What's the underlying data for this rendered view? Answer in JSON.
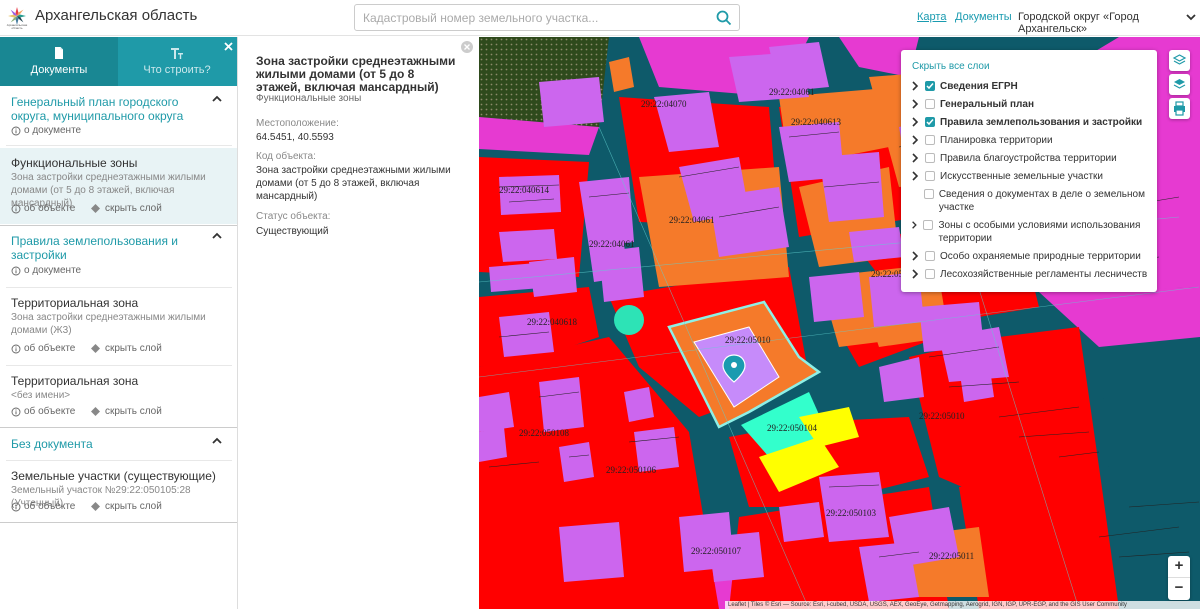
{
  "header": {
    "logo_text": "Архангельская область",
    "title": "Архангельская область",
    "search_placeholder": "Кадастровый номер земельного участка...",
    "nav_map": "Карта",
    "nav_docs": "Документы",
    "district": "Городской округ «Город Архангельск»"
  },
  "tabs": {
    "documents": "Документы",
    "what_to_build": "Что строить?"
  },
  "left": {
    "sec1_title": "Генеральный план городского округа, муниципального округа",
    "sec1_about": "о документе",
    "func_title": "Функциональные зоны",
    "func_sub": "Зона застройки среднеэтажными жилыми домами (от 5 до 8 этажей, включая мансардный)",
    "about_object": "об объекте",
    "hide_layer": "скрыть слой",
    "sec2_title": "Правила землепользования и застройки",
    "sec2_about": "о документе",
    "terr1_title": "Территориальная зона",
    "terr1_sub": "Зона застройки среднеэтажными жилыми домами (Ж3)",
    "terr2_title": "Территориальная зона",
    "terr2_sub": "<без имени>",
    "sec3_title": "Без документа",
    "land_title": "Земельные участки (существующие)",
    "land_sub": "Земельный участок №29:22:050105:28 (Учтенный)"
  },
  "info": {
    "title": "Зона застройки среднеэтажными жилыми домами (от 5 до 8 этажей, включая мансардный)",
    "subtitle": "Функциональные зоны",
    "location_label": "Местоположение:",
    "location_value": "64.5451, 40.5593",
    "code_label": "Код объекта:",
    "code_value": "Зона застройки среднеэтажными жилыми домами (от 5 до 8 этажей, включая мансардный)",
    "status_label": "Статус объекта:",
    "status_value": "Существующий"
  },
  "layers": {
    "hide_all": "Скрыть все слои",
    "items": [
      {
        "label": "Сведения ЕГРН",
        "checked": true,
        "bold": true
      },
      {
        "label": "Генеральный план",
        "checked": false,
        "bold": true
      },
      {
        "label": "Правила землепользования и застройки",
        "checked": true,
        "bold": true
      },
      {
        "label": "Планировка территории",
        "checked": false,
        "bold": false
      },
      {
        "label": "Правила благоустройства территории",
        "checked": false,
        "bold": false
      },
      {
        "label": "Искусственные земельные участки",
        "checked": false,
        "bold": false
      },
      {
        "label": "Сведения о документах в деле о земельном участке",
        "checked": false,
        "bold": false
      },
      {
        "label": "Зоны с особыми условиями использования территории",
        "checked": false,
        "bold": false
      },
      {
        "label": "Особо охраняемые природные территории",
        "checked": false,
        "bold": false
      },
      {
        "label": "Лесохозяйственные регламенты лесничеств",
        "checked": false,
        "bold": false
      }
    ]
  },
  "map": {
    "labels": [
      "29:22:04070",
      "29:22:04061",
      "29:22:040614",
      "29:22:040613",
      "29:22:04061",
      "29:22:04061",
      "29:22:050",
      "29:22:040618",
      "29:22:05010",
      "29:22:050108",
      "29:22:050104",
      "29:22:050106",
      "29:22:05010",
      "29:22:050103",
      "29:22:050107",
      "29:22:05011"
    ],
    "zoom_in": "+",
    "zoom_out": "−",
    "attribution": "Leaflet | Tiles © Esri — Source: Esri, i-cubed, USDA, USGS, AEX, GeoEye, Getmapping, Aerogrid, IGN, IGP, UPR-EGP, and the GIS User Community"
  },
  "colors": {
    "accent": "#1f9aa8",
    "zone_red": "#ff0000",
    "zone_orange": "#f57a2a",
    "zone_violet": "#cc66ee",
    "zone_magenta": "#e63ad1",
    "street": "#0e5a6a"
  }
}
